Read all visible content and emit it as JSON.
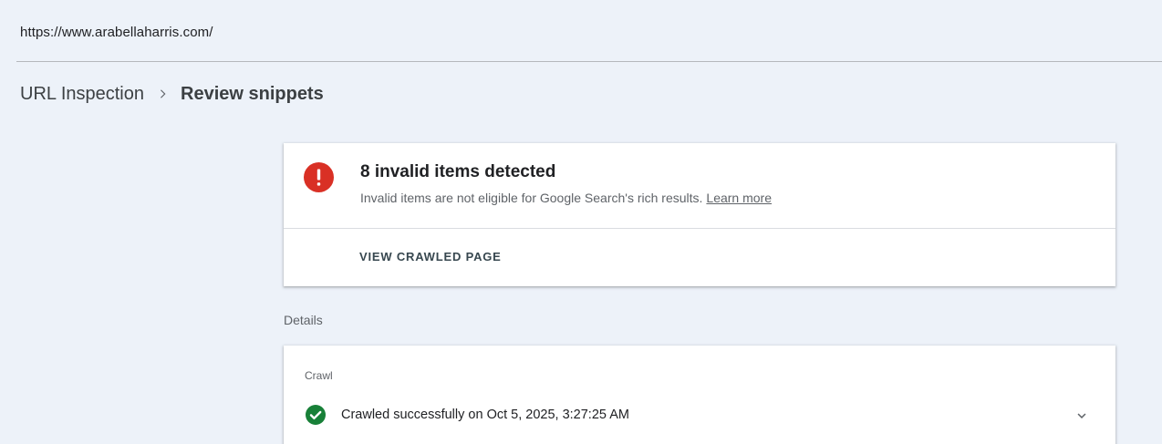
{
  "url_bar": {
    "url": "https://www.arabellaharris.com/"
  },
  "breadcrumb": {
    "parent": "URL Inspection",
    "current": "Review snippets"
  },
  "status_card": {
    "title": "8 invalid items detected",
    "description": "Invalid items are not eligible for Google Search's rich results.",
    "learn_more": "Learn more",
    "action": "VIEW CRAWLED PAGE",
    "icon": "error-icon",
    "icon_color": "#d93025"
  },
  "details": {
    "label": "Details",
    "crawl": {
      "label": "Crawl",
      "status_text": "Crawled successfully on Oct 5, 2025, 3:27:25 AM",
      "icon": "check-circle-icon",
      "icon_color": "#188038"
    }
  }
}
